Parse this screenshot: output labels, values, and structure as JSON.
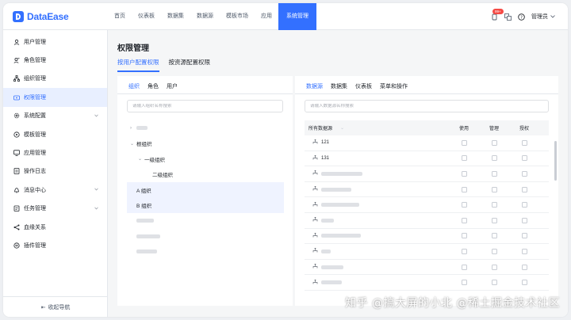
{
  "app": {
    "brand": "DataEase"
  },
  "nav": {
    "items": [
      "首页",
      "仪表板",
      "数据集",
      "数据源",
      "模板市场",
      "应用",
      "系统管理"
    ],
    "active_index": 6
  },
  "topbar": {
    "badge": "99+",
    "user_label": "管理员"
  },
  "sidebar": {
    "items": [
      {
        "label": "用户管理",
        "icon": "user-icon"
      },
      {
        "label": "角色管理",
        "icon": "role-icon"
      },
      {
        "label": "组织管理",
        "icon": "org-icon"
      },
      {
        "label": "权限管理",
        "icon": "permission-icon",
        "active": true
      },
      {
        "label": "系统配置",
        "icon": "settings-icon",
        "expandable": true
      },
      {
        "label": "模板管理",
        "icon": "template-icon"
      },
      {
        "label": "应用管理",
        "icon": "app-icon"
      },
      {
        "label": "操作日志",
        "icon": "log-icon"
      },
      {
        "label": "消息中心",
        "icon": "bell-icon",
        "expandable": true
      },
      {
        "label": "任务管理",
        "icon": "task-icon",
        "expandable": true
      },
      {
        "label": "血缘关系",
        "icon": "lineage-icon"
      },
      {
        "label": "插件管理",
        "icon": "plugin-icon"
      }
    ],
    "collapse_label": "收起导航"
  },
  "main": {
    "title": "权限管理",
    "tabs": [
      "按用户配置权限",
      "按资源配置权限"
    ],
    "active_tab": 0
  },
  "left_panel": {
    "tabs": [
      "组织",
      "角色",
      "用户"
    ],
    "active_tab": 0,
    "search_placeholder": "请输入组织名称搜索",
    "tree": [
      {
        "label": "",
        "level": 0,
        "blurred": true,
        "arrow": "›",
        "blur_width": 14
      },
      {
        "label": "根组织",
        "level": 0,
        "arrow": "⌄"
      },
      {
        "label": "一级组织",
        "level": 1,
        "arrow": "⌄"
      },
      {
        "label": "二级组织",
        "level": 2,
        "arrow": ""
      },
      {
        "label": "A 组织",
        "level": 0,
        "arrow": "",
        "selected": true
      },
      {
        "label": "B 组织",
        "level": 0,
        "arrow": "",
        "selected": true
      },
      {
        "label": "",
        "level": 0,
        "blurred": true,
        "arrow": "",
        "blur_width": 22
      },
      {
        "label": "",
        "level": 0,
        "blurred": true,
        "arrow": "",
        "blur_width": 30
      },
      {
        "label": "",
        "level": 0,
        "blurred": true,
        "arrow": "",
        "blur_width": 26
      }
    ]
  },
  "right_panel": {
    "tabs": [
      "数据源",
      "数据集",
      "仪表板",
      "菜单和操作"
    ],
    "active_tab": 0,
    "search_placeholder": "请输入数据源名称搜索",
    "columns": [
      "所有数据源",
      "使用",
      "管理",
      "授权"
    ],
    "rows": [
      {
        "name": "121",
        "blurred": false
      },
      {
        "name": "131",
        "blurred": false
      },
      {
        "name": "",
        "blurred": true,
        "blur_width": 52
      },
      {
        "name": "",
        "blurred": true,
        "blur_width": 38
      },
      {
        "name": "",
        "blurred": true,
        "blur_width": 48
      },
      {
        "name": "",
        "blurred": true,
        "blur_width": 16
      },
      {
        "name": "",
        "blurred": true,
        "blur_width": 50
      },
      {
        "name": "",
        "blurred": true,
        "blur_width": 12
      },
      {
        "name": "",
        "blurred": true,
        "blur_width": 28
      },
      {
        "name": "",
        "blurred": true,
        "blur_width": 26
      }
    ]
  },
  "watermark": "知乎 @搞大屏的小北 @稀土掘金技术社区"
}
